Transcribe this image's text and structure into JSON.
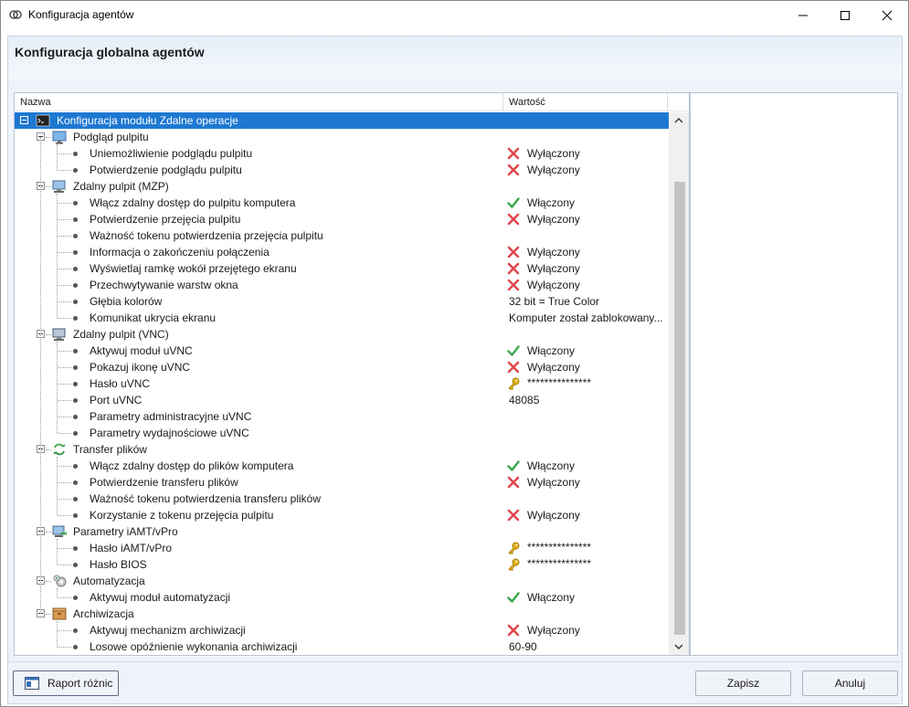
{
  "window": {
    "title": "Konfiguracja agentów",
    "controls": {
      "minimize": "minimize-icon",
      "maximize": "maximize-icon",
      "close": "close-icon"
    }
  },
  "header": {
    "title": "Konfiguracja globalna agentów"
  },
  "columns": {
    "name": "Nazwa",
    "value": "Wartość"
  },
  "tree": [
    {
      "type": "root",
      "label": "Konfiguracja modułu Zdalne operacje",
      "icon": "console-icon",
      "selected": true
    },
    {
      "type": "group",
      "label": "Podgląd pulpitu",
      "icon": "monitor-icon"
    },
    {
      "type": "item",
      "label": "Uniemożliwienie podglądu pulpitu",
      "status": "off",
      "value": "Wyłączony"
    },
    {
      "type": "item",
      "label": "Potwierdzenie podglądu pulpitu",
      "status": "off",
      "value": "Wyłączony"
    },
    {
      "type": "group",
      "label": "Zdalny pulpit (MZP)",
      "icon": "computer-icon"
    },
    {
      "type": "item",
      "label": "Włącz zdalny dostęp do pulpitu komputera",
      "status": "on",
      "value": "Włączony"
    },
    {
      "type": "item",
      "label": "Potwierdzenie przejęcia pulpitu",
      "status": "off",
      "value": "Wyłączony"
    },
    {
      "type": "item",
      "label": "Ważność tokenu potwierdzenia przejęcia pulpitu",
      "status": "none",
      "value": ""
    },
    {
      "type": "item",
      "label": "Informacja o zakończeniu połączenia",
      "status": "off",
      "value": "Wyłączony"
    },
    {
      "type": "item",
      "label": "Wyświetlaj ramkę wokół przejętego ekranu",
      "status": "off",
      "value": "Wyłączony"
    },
    {
      "type": "item",
      "label": "Przechwytywanie warstw okna",
      "status": "off",
      "value": "Wyłączony"
    },
    {
      "type": "item",
      "label": "Głębia kolorów",
      "status": "text",
      "value": "32 bit = True Color"
    },
    {
      "type": "item",
      "label": "Komunikat ukrycia ekranu",
      "status": "text",
      "value": "Komputer został zablokowany..."
    },
    {
      "type": "group",
      "label": "Zdalny pulpit (VNC)",
      "icon": "vnc-computer-icon"
    },
    {
      "type": "item",
      "label": "Aktywuj moduł uVNC",
      "status": "on",
      "value": "Włączony"
    },
    {
      "type": "item",
      "label": "Pokazuj ikonę uVNC",
      "status": "off",
      "value": "Wyłączony"
    },
    {
      "type": "item",
      "label": "Hasło uVNC",
      "status": "key",
      "value": "***************"
    },
    {
      "type": "item",
      "label": "Port uVNC",
      "status": "text",
      "value": "48085"
    },
    {
      "type": "item",
      "label": "Parametry administracyjne uVNC",
      "status": "none",
      "value": ""
    },
    {
      "type": "item",
      "label": "Parametry wydajnościowe uVNC",
      "status": "none",
      "value": ""
    },
    {
      "type": "group",
      "label": "Transfer plików",
      "icon": "transfer-arrows-icon"
    },
    {
      "type": "item",
      "label": "Włącz zdalny dostęp do plików komputera",
      "status": "on",
      "value": "Włączony"
    },
    {
      "type": "item",
      "label": "Potwierdzenie transferu plików",
      "status": "off",
      "value": "Wyłączony"
    },
    {
      "type": "item",
      "label": "Ważność tokenu potwierdzenia transferu plików",
      "status": "none",
      "value": ""
    },
    {
      "type": "item",
      "label": "Korzystanie z tokenu przejęcia pulpitu",
      "status": "off",
      "value": "Wyłączony"
    },
    {
      "type": "group",
      "label": "Parametry iAMT/vPro",
      "icon": "amt-computer-icon"
    },
    {
      "type": "item",
      "label": "Hasło iAMT/vPro",
      "status": "key",
      "value": "***************"
    },
    {
      "type": "item",
      "label": "Hasło BIOS",
      "status": "key",
      "value": "***************"
    },
    {
      "type": "group",
      "label": "Automatyzacja",
      "icon": "gears-icon"
    },
    {
      "type": "item",
      "label": "Aktywuj moduł automatyzacji",
      "status": "on",
      "value": "Włączony"
    },
    {
      "type": "group",
      "label": "Archiwizacja",
      "icon": "archive-box-icon"
    },
    {
      "type": "item",
      "label": "Aktywuj mechanizm archiwizacji",
      "status": "off",
      "value": "Wyłączony"
    },
    {
      "type": "item",
      "label": "Losowe opóźnienie wykonania archiwizacji",
      "status": "text",
      "value": "60-90"
    }
  ],
  "footer": {
    "report_label": "Raport różnic",
    "report_icon": "report-window-icon",
    "save_label": "Zapisz",
    "cancel_label": "Anuluj"
  },
  "colors": {
    "selection": "#1e78d2",
    "on_check": "#3aa64a",
    "off_cross": "#e0474c",
    "key": "#e3b21a"
  }
}
